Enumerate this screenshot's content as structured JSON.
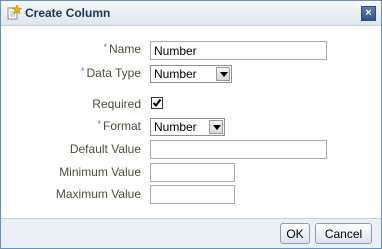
{
  "dialog": {
    "title": "Create Column",
    "title_icon": "star-icon",
    "close_glyph": "×"
  },
  "form": {
    "required_marker": "*",
    "name": {
      "label": "Name",
      "value": "Number",
      "required": true
    },
    "data_type": {
      "label": "Data Type",
      "value": "Number",
      "required": true
    },
    "required_field": {
      "label": "Required",
      "checked": true
    },
    "format": {
      "label": "Format",
      "value": "Number",
      "required": true
    },
    "default_value": {
      "label": "Default Value",
      "value": ""
    },
    "minimum_value": {
      "label": "Minimum Value",
      "value": ""
    },
    "maximum_value": {
      "label": "Maximum Value",
      "value": ""
    }
  },
  "buttons": {
    "ok_label": "OK",
    "cancel_label": "Cancel"
  },
  "colors": {
    "title_text": "#1b3453",
    "label_text": "#4d4d3a",
    "required_marker": "#4a7ab3",
    "border": "#6d8fb5"
  }
}
